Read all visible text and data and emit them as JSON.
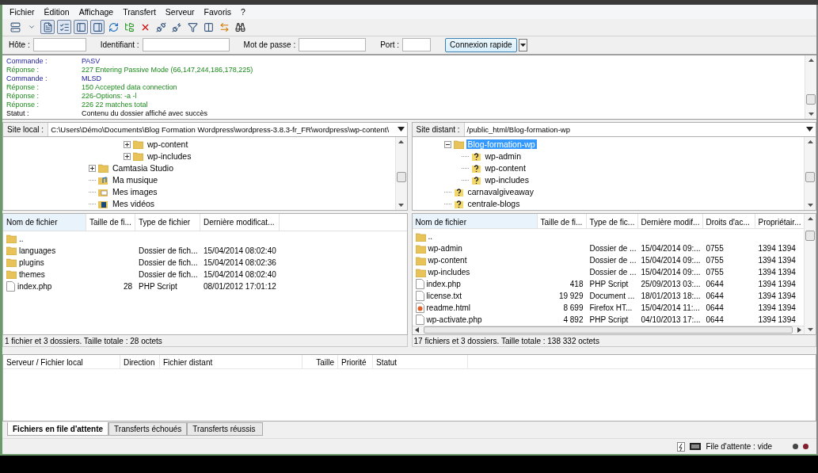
{
  "menu": [
    "Fichier",
    "Édition",
    "Affichage",
    "Transfert",
    "Serveur",
    "Favoris",
    "?"
  ],
  "toolbar": [
    {
      "kind": "sitemanager",
      "pressed": false
    },
    {
      "kind": "dropdown",
      "pressed": false
    },
    {
      "kind": "log",
      "pressed": true
    },
    {
      "kind": "tree",
      "pressed": true
    },
    {
      "kind": "localtree",
      "pressed": true
    },
    {
      "kind": "remotetree",
      "pressed": true
    },
    {
      "kind": "refresh",
      "pressed": false
    },
    {
      "kind": "process",
      "pressed": false
    },
    {
      "kind": "cancel",
      "pressed": false
    },
    {
      "kind": "disconnect",
      "pressed": false
    },
    {
      "kind": "reconnect",
      "pressed": false
    },
    {
      "kind": "filter",
      "pressed": false
    },
    {
      "kind": "compare",
      "pressed": false
    },
    {
      "kind": "sync",
      "pressed": false
    },
    {
      "kind": "search",
      "pressed": false
    }
  ],
  "quickconnect": {
    "fields": [
      {
        "label": "Hôte :"
      },
      {
        "label": "Identifiant :"
      },
      {
        "label": "Mot de passe :"
      },
      {
        "label": "Port :"
      }
    ],
    "button": "Connexion rapide"
  },
  "log": [
    {
      "kind": "command",
      "label": "Commande :",
      "text": "PASV"
    },
    {
      "kind": "response",
      "label": "Réponse :",
      "text": "227 Entering Passive Mode (66,147,244,186,178,225)"
    },
    {
      "kind": "command",
      "label": "Commande :",
      "text": "MLSD"
    },
    {
      "kind": "response",
      "label": "Réponse :",
      "text": "150 Accepted data connection"
    },
    {
      "kind": "response",
      "label": "Réponse :",
      "text": "226-Options: -a -l"
    },
    {
      "kind": "response",
      "label": "Réponse :",
      "text": "226 22 matches total"
    },
    {
      "kind": "status",
      "label": "Statut :",
      "text": "Contenu du dossier affiché avec succès"
    }
  ],
  "local": {
    "site_label": "Site local :",
    "path": "C:\\Users\\Démo\\Documents\\Blog Formation Wordpress\\wordpress-3.8.3-fr_FR\\wordpress\\wp-content\\",
    "tree": [
      {
        "children": [
          {
            "children": [
              {
                "label": "wp-content",
                "kind": "folder",
                "expanded": false,
                "selected": false
              },
              {
                "label": "wp-includes",
                "kind": "folder",
                "expanded": false,
                "selected": false
              }
            ]
          }
        ]
      },
      {
        "label": "Camtasia Studio",
        "kind": "folder",
        "expanded": false,
        "selected": false
      },
      {
        "label": "Ma musique",
        "kind": "music",
        "selected": false
      },
      {
        "label": "Mes images",
        "kind": "images",
        "selected": false
      },
      {
        "label": "Mes vidéos",
        "kind": "videos",
        "selected": false
      }
    ],
    "columns": [
      "Nom de fichier",
      "Taille de fi...",
      "Type de fichier",
      "Dernière modificat..."
    ],
    "rows": [
      {
        "kind": "folder",
        "cells": [
          "..",
          "",
          "",
          ""
        ]
      },
      {
        "kind": "folder",
        "cells": [
          "languages",
          "",
          "Dossier de fich...",
          "15/04/2014 08:02:40"
        ]
      },
      {
        "kind": "folder",
        "cells": [
          "plugins",
          "",
          "Dossier de fich...",
          "15/04/2014 08:02:36"
        ]
      },
      {
        "kind": "folder",
        "cells": [
          "themes",
          "",
          "Dossier de fich...",
          "15/04/2014 08:02:40"
        ]
      },
      {
        "kind": "file",
        "cells": [
          "index.php",
          "28",
          "PHP Script",
          "08/01/2012 17:01:12"
        ]
      }
    ],
    "status": "1 fichier et 3 dossiers. Taille totale : 28 octets"
  },
  "remote": {
    "site_label": "Site distant :",
    "path": "/public_html/Blog-formation-wp",
    "tree": [
      {
        "label": "Blog-formation-wp",
        "kind": "folder",
        "expanded": true,
        "selected": true,
        "children": [
          {
            "label": "wp-admin",
            "kind": "unknown",
            "selected": false
          },
          {
            "label": "wp-content",
            "kind": "unknown",
            "selected": false
          },
          {
            "label": "wp-includes",
            "kind": "unknown",
            "selected": false
          }
        ]
      },
      {
        "label": "carnavalgiveaway",
        "kind": "unknown",
        "selected": false
      },
      {
        "label": "centrale-blogs",
        "kind": "unknown",
        "selected": false
      }
    ],
    "columns": [
      "Nom de fichier",
      "Taille de fi...",
      "Type de fic...",
      "Dernière modif...",
      "Droits d'ac...",
      "Propriétair..."
    ],
    "rows": [
      {
        "kind": "folder",
        "cells": [
          "..",
          "",
          "",
          "",
          "",
          ""
        ]
      },
      {
        "kind": "folder",
        "cells": [
          "wp-admin",
          "",
          "Dossier de ...",
          "15/04/2014 09:...",
          "0755",
          "1394 1394"
        ]
      },
      {
        "kind": "folder",
        "cells": [
          "wp-content",
          "",
          "Dossier de ...",
          "15/04/2014 09:...",
          "0755",
          "1394 1394"
        ]
      },
      {
        "kind": "folder",
        "cells": [
          "wp-includes",
          "",
          "Dossier de ...",
          "15/04/2014 09:...",
          "0755",
          "1394 1394"
        ]
      },
      {
        "kind": "file",
        "cells": [
          "index.php",
          "418",
          "PHP Script",
          "25/09/2013 03:...",
          "0644",
          "1394 1394"
        ]
      },
      {
        "kind": "file",
        "cells": [
          "license.txt",
          "19 929",
          "Document ...",
          "18/01/2013 18:...",
          "0644",
          "1394 1394"
        ]
      },
      {
        "kind": "html",
        "cells": [
          "readme.html",
          "8 699",
          "Firefox HT...",
          "15/04/2014 11:...",
          "0644",
          "1394 1394"
        ]
      },
      {
        "kind": "file",
        "cells": [
          "wp-activate.php",
          "4 892",
          "PHP Script",
          "04/10/2013 17:...",
          "0644",
          "1394 1394"
        ]
      }
    ],
    "status": "17 fichiers et 3 dossiers. Taille totale : 138 332 octets"
  },
  "queue": {
    "columns": [
      "Serveur / Fichier local",
      "Direction",
      "Fichier distant",
      "Taille",
      "Priorité",
      "Statut"
    ],
    "tabs": [
      {
        "label": "Fichiers en file d'attente",
        "selected": true
      },
      {
        "label": "Transferts échoués",
        "selected": false
      },
      {
        "label": "Transferts réussis",
        "selected": false
      }
    ]
  },
  "status_bar": {
    "queue": "File d'attente : vide"
  }
}
